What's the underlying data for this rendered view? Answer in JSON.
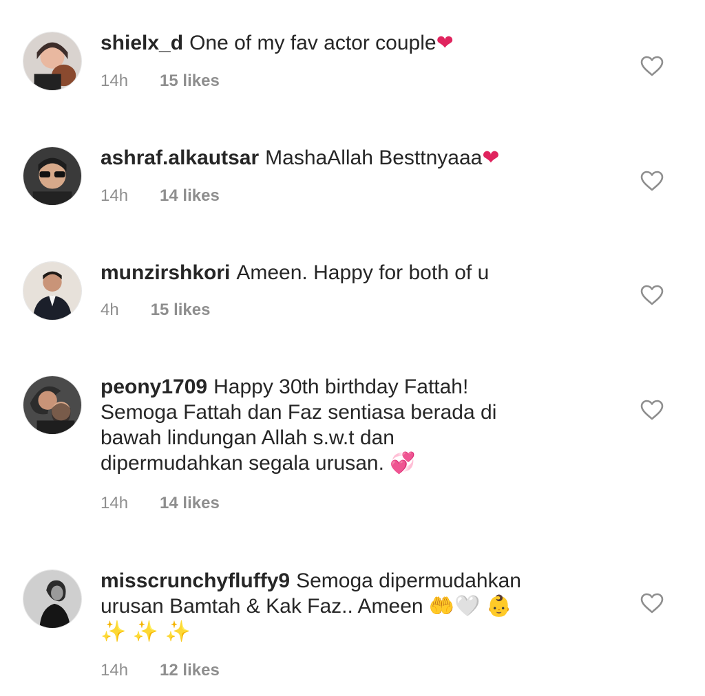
{
  "comments": [
    {
      "username": "shielx_d",
      "text": "One of my fav actor couple",
      "emoji": "❤",
      "time": "14h",
      "likes": "15 likes"
    },
    {
      "username": "ashraf.alkautsar",
      "text": "MashaAllah Besttnyaaa",
      "emoji": "❤",
      "time": "14h",
      "likes": "14 likes"
    },
    {
      "username": "munzirshkori",
      "text": "Ameen. Happy for both of u",
      "time": "4h",
      "likes": "15 likes"
    },
    {
      "username": "peony1709",
      "text_lines": [
        "Happy 30th birthday Fattah!",
        "Semoga Fattah dan Faz sentiasa berada di",
        "bawah lindungan Allah s.w.t dan",
        "dipermudahkan segala urusan."
      ],
      "emoji": "💞",
      "time": "14h",
      "likes": "14 likes"
    },
    {
      "username": "misscrunchyfluffy9",
      "text_lines": [
        "Semoga dipermudahkan",
        "urusan Bamtah & Kak Faz.. Ameen",
        "✨ ✨ ✨"
      ],
      "emojis": [
        "🤲",
        "🤍",
        "👶"
      ],
      "time": "14h",
      "likes": "12 likes"
    }
  ],
  "icons": {
    "like": "heart-outline-icon"
  },
  "colors": {
    "text": "#262626",
    "meta": "#8e8e8e",
    "heart_outline": "#8e8e8e"
  }
}
